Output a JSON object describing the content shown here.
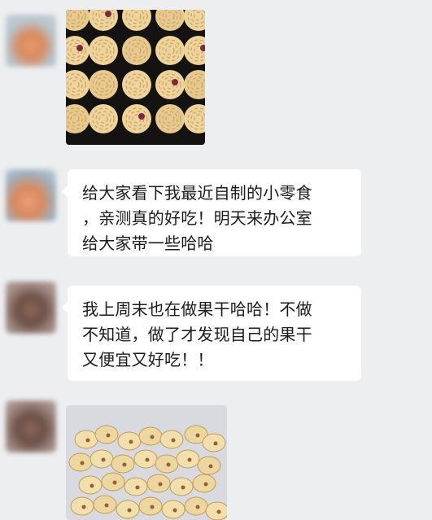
{
  "chat": {
    "messages": [
      {
        "type": "image",
        "avatar_icon": "user-avatar",
        "image_subject": "cookies-photo"
      },
      {
        "type": "text",
        "avatar_icon": "user-avatar",
        "text": "给大家看下我最近自制的小零食\n，亲测真的好吃！明天来办公室\n给大家带一些哈哈"
      },
      {
        "type": "text",
        "avatar_icon": "user-avatar",
        "text": "我上周末也在做果干哈哈！不做\n不知道，做了才发现自己的果干\n又便宜又好吃！！"
      },
      {
        "type": "image",
        "avatar_icon": "user-avatar",
        "image_subject": "dried-banana-chips-photo"
      }
    ]
  }
}
